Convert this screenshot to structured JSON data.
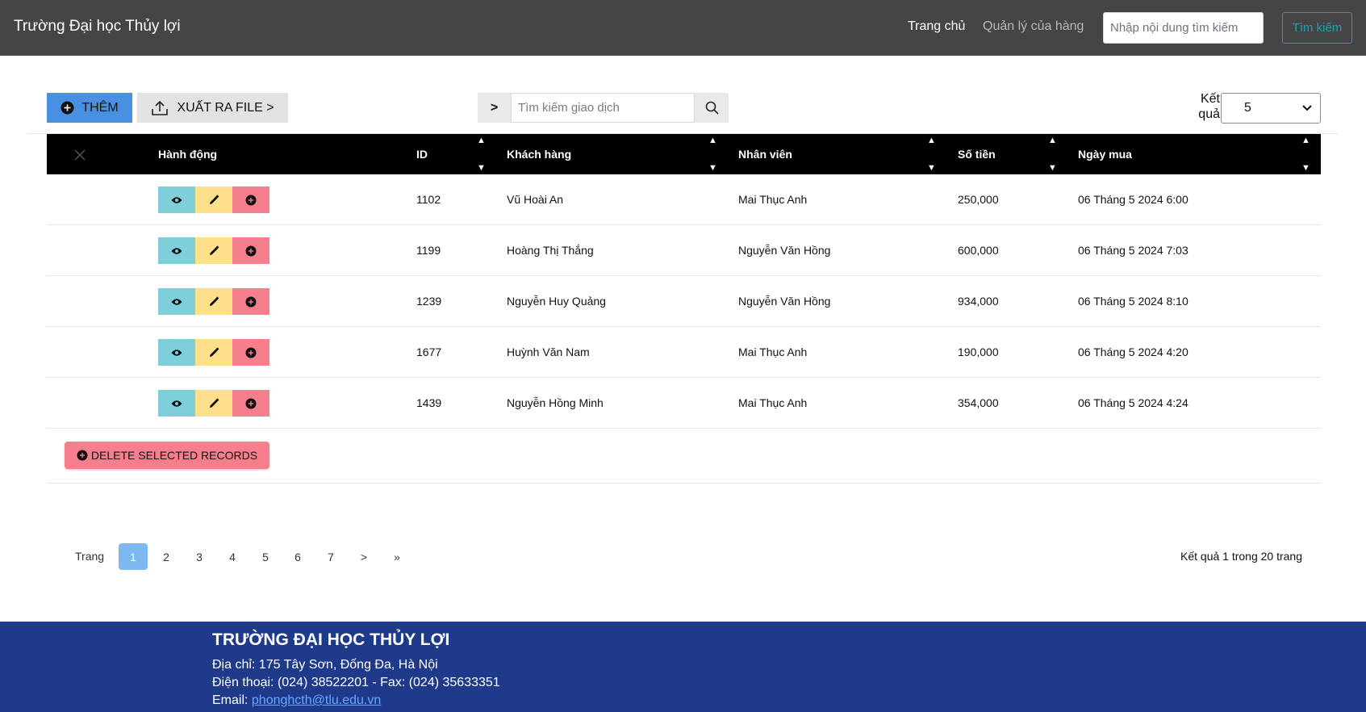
{
  "navbar": {
    "brand": "Trường Đại học Thủy lợi",
    "home_link": "Trang chủ",
    "shop_link": "Quản lý của hàng",
    "search_placeholder": "Nhập nội dung tìm kiếm",
    "search_button": "Tìm kiếm"
  },
  "toolbar": {
    "add_label": "THÊM",
    "export_label": "XUẤT RA FILE >",
    "search_prefix": ">",
    "search_placeholder": "Tìm kiếm giao dịch",
    "result_label": "Kết quả",
    "page_size": "5"
  },
  "table": {
    "columns": [
      "Hành động",
      "ID",
      "Khách hàng",
      "Nhân viên",
      "Số tiền",
      "Ngày mua"
    ],
    "rows": [
      {
        "id": "1102",
        "customer": "Vũ Hoài An",
        "staff": "Mai Thục Anh",
        "amount": "250,000",
        "date": "06 Tháng 5 2024 6:00"
      },
      {
        "id": "1199",
        "customer": "Hoàng Thị Thắng",
        "staff": "Nguyễn Văn Hồng",
        "amount": "600,000",
        "date": "06 Tháng 5 2024 7:03"
      },
      {
        "id": "1239",
        "customer": "Nguyễn Huy Quảng",
        "staff": "Nguyễn Văn Hồng",
        "amount": "934,000",
        "date": "06 Tháng 5 2024 8:10"
      },
      {
        "id": "1677",
        "customer": "Huỳnh Văn Nam",
        "staff": "Mai Thục Anh",
        "amount": "190,000",
        "date": "06 Tháng 5 2024 4:20"
      },
      {
        "id": "1439",
        "customer": "Nguyễn Hồng Minh",
        "staff": "Mai Thục Anh",
        "amount": "354,000",
        "date": "06 Tháng 5 2024 4:24"
      }
    ],
    "delete_selected_label": "DELETE SELECTED RECORDS"
  },
  "pagination": {
    "label": "Trang",
    "pages": [
      "1",
      "2",
      "3",
      "4",
      "5",
      "6",
      "7"
    ],
    "current": "1",
    "next": ">",
    "last": "»",
    "summary": "Kết quả 1 trong 20 trang"
  },
  "footer": {
    "title": "TRƯỜNG ĐẠI HỌC THỦY LỢI",
    "address": "Địa chỉ: 175 Tây Sơn, Đống Đa, Hà Nội",
    "phone": "Điện thoại: (024) 38522201 - Fax: (024) 35633351",
    "email_label": "Email: ",
    "email": "phonghcth@tlu.edu.vn"
  },
  "colors": {
    "navbar_bg": "#454545",
    "primary": "#4a90e2",
    "view": "#7ecfd9",
    "edit": "#ffe08a",
    "delete": "#f77f8d",
    "footer_bg": "#1f3a8a"
  }
}
